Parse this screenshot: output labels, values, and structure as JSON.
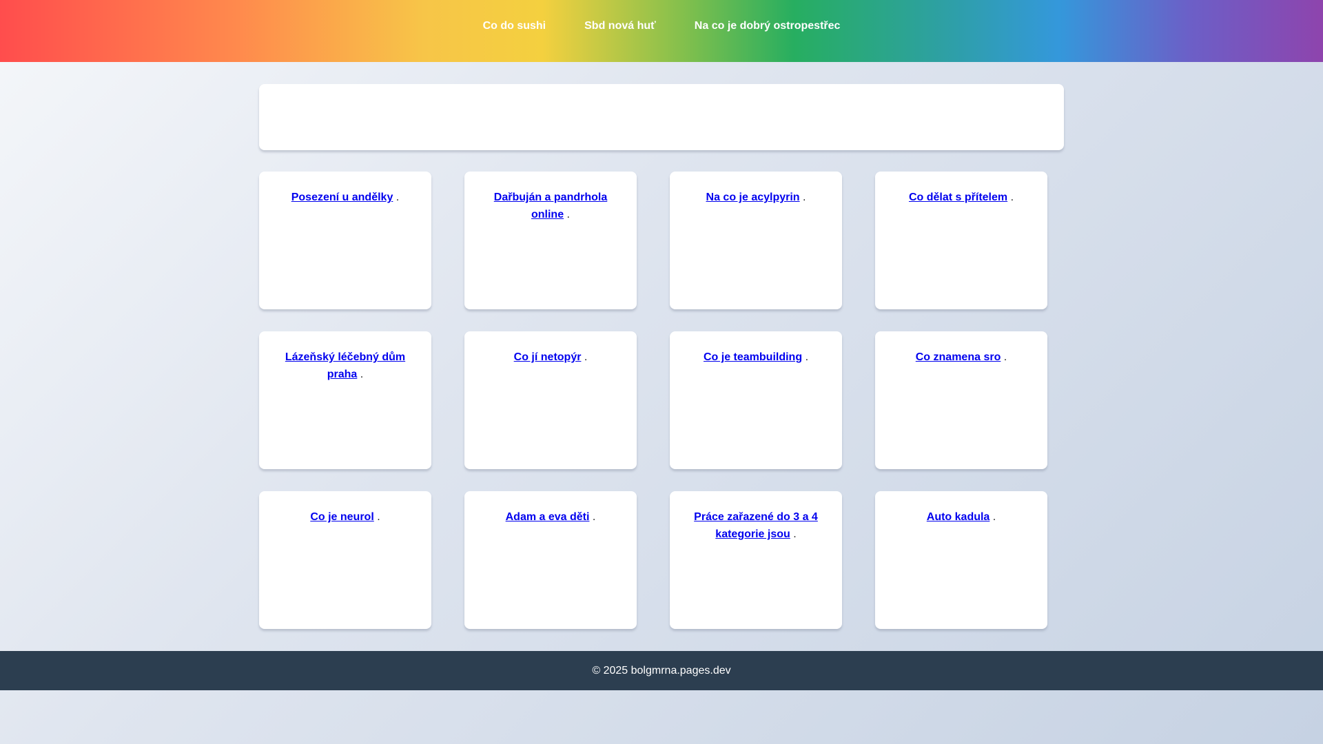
{
  "nav": {
    "links": [
      {
        "label": "Co do sushi"
      },
      {
        "label": "Sbd nová huť"
      },
      {
        "label": "Na co je dobrý ostropestřec"
      }
    ]
  },
  "cards": [
    {
      "link": "Posezení u andělky",
      "suffix": "."
    },
    {
      "link": "Dařbuján a pandrhola online",
      "suffix": "."
    },
    {
      "link": "Na co je acylpyrin",
      "suffix": "."
    },
    {
      "link": "Co dělat s přítelem",
      "suffix": "."
    },
    {
      "link": "Lázeňský léčebný dům praha",
      "suffix": "."
    },
    {
      "link": "Co jí netopýr",
      "suffix": "."
    },
    {
      "link": "Co je teambuilding",
      "suffix": "."
    },
    {
      "link": "Co znamena sro",
      "suffix": "."
    },
    {
      "link": "Co je neurol",
      "suffix": "."
    },
    {
      "link": "Adam a eva děti",
      "suffix": "."
    },
    {
      "link": "Práce zařazené do 3 a 4 kategorie jsou",
      "suffix": "."
    },
    {
      "link": "Auto kadula",
      "suffix": "."
    }
  ],
  "footer": {
    "text": "© 2025 bolgmrna.pages.dev"
  }
}
